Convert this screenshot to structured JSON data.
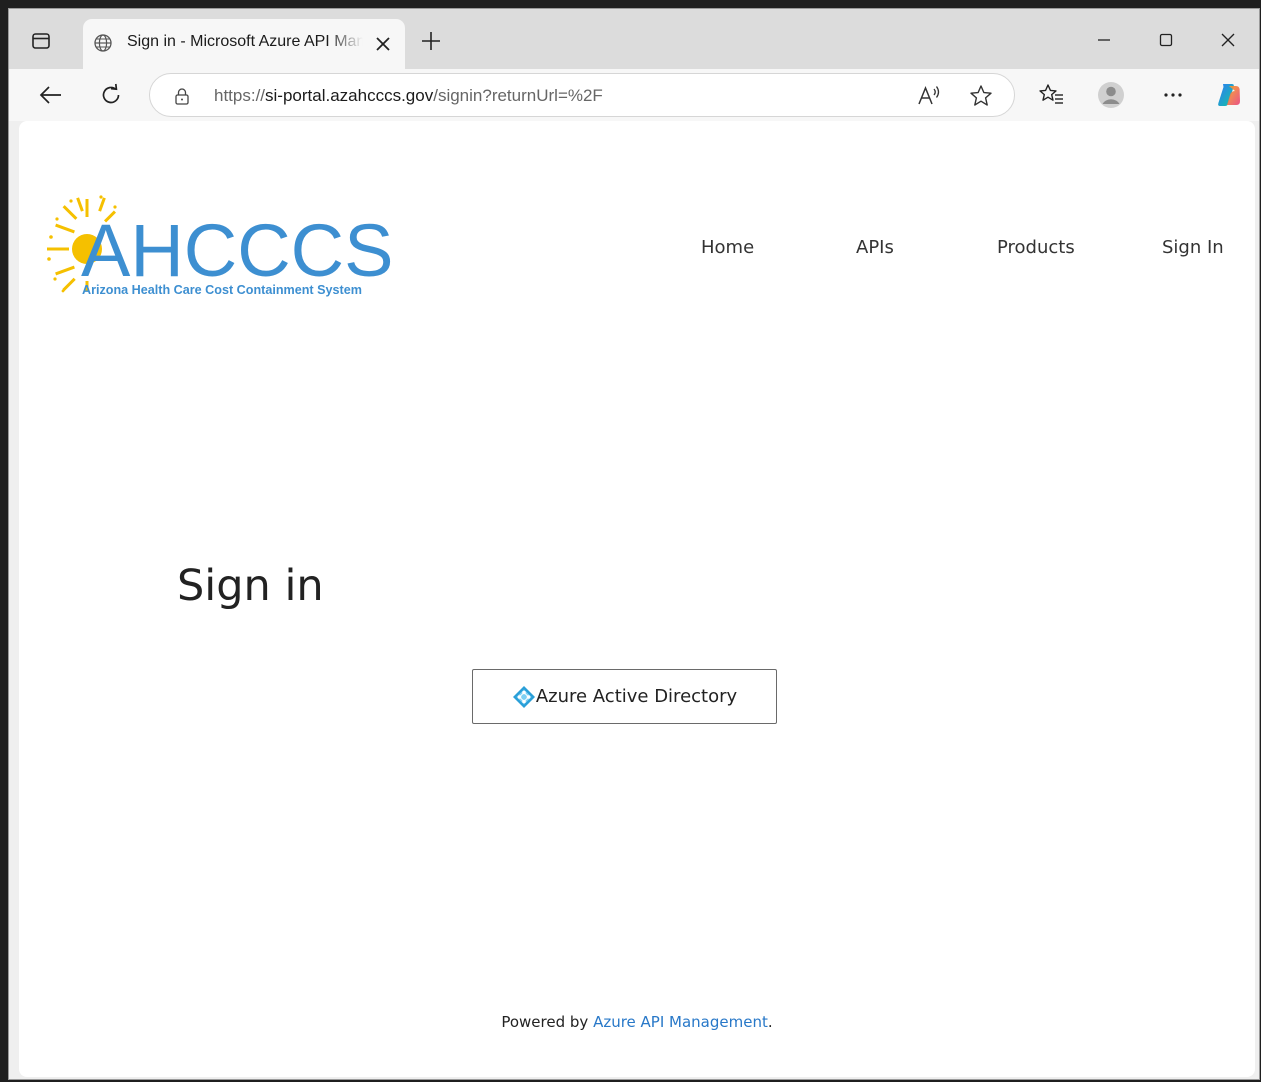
{
  "browser": {
    "tab": {
      "title": "Sign in - Microsoft Azure API Management"
    },
    "address_bar": {
      "scheme": "https://",
      "host": "si-portal.azahcccs.gov",
      "path": "/signin?returnUrl=%2F"
    },
    "icons": [
      "tab-actions-icon",
      "globe-icon",
      "close-icon",
      "plus-icon",
      "minimize-icon",
      "maximize-icon",
      "close-window-icon",
      "back-arrow-icon",
      "reload-icon",
      "lock-icon",
      "read-aloud-icon",
      "star-icon",
      "favorites-icon",
      "profile-icon",
      "more-icon",
      "copilot-icon"
    ]
  },
  "header": {
    "logo": {
      "wordmark": "AHCCCS",
      "tagline": "Arizona Health Care Cost Containment System"
    },
    "nav": [
      {
        "label": "Home"
      },
      {
        "label": "APIs"
      },
      {
        "label": "Products"
      },
      {
        "label": "Sign In"
      }
    ]
  },
  "main": {
    "heading": "Sign in",
    "provider_button": {
      "label": "Azure Active Directory",
      "icon": "azure-ad-icon"
    }
  },
  "footer": {
    "prefix": "Powered by ",
    "link": "Azure API Management",
    "suffix": "."
  },
  "colors": {
    "logo_blue": "#3d8fd1",
    "logo_sun": "#f5c000",
    "link_blue": "#2878c8",
    "azure_ad_blue": "#2a9fd8"
  }
}
